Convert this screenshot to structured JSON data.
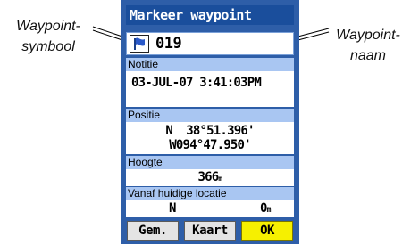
{
  "callouts": {
    "left": {
      "line1": "Waypoint-",
      "line2": "symbool"
    },
    "right": {
      "line1": "Waypoint-",
      "line2": "naam"
    }
  },
  "screen": {
    "title": "Markeer waypoint",
    "waypoint": {
      "symbol_icon": "blue-flag-icon",
      "name": "019"
    },
    "note": {
      "label": "Notitie",
      "value": "03-JUL-07 3:41:03PM"
    },
    "position": {
      "label": "Positie",
      "lat": "N  38°51.396'",
      "lon": "W094°47.950'"
    },
    "altitude": {
      "label": "Hoogte",
      "value": "366",
      "unit": "m"
    },
    "distance": {
      "label": "Vanaf huidige locatie",
      "bearing": "N",
      "value": "0",
      "unit": "m"
    },
    "softkeys": {
      "average": "Gem.",
      "map": "Kaart",
      "ok": "OK"
    }
  },
  "colors": {
    "bezel": "#2e5ea8",
    "title_bar": "#1a4e9c",
    "section_label": "#a9c6f2",
    "ok_button": "#f6f000"
  }
}
